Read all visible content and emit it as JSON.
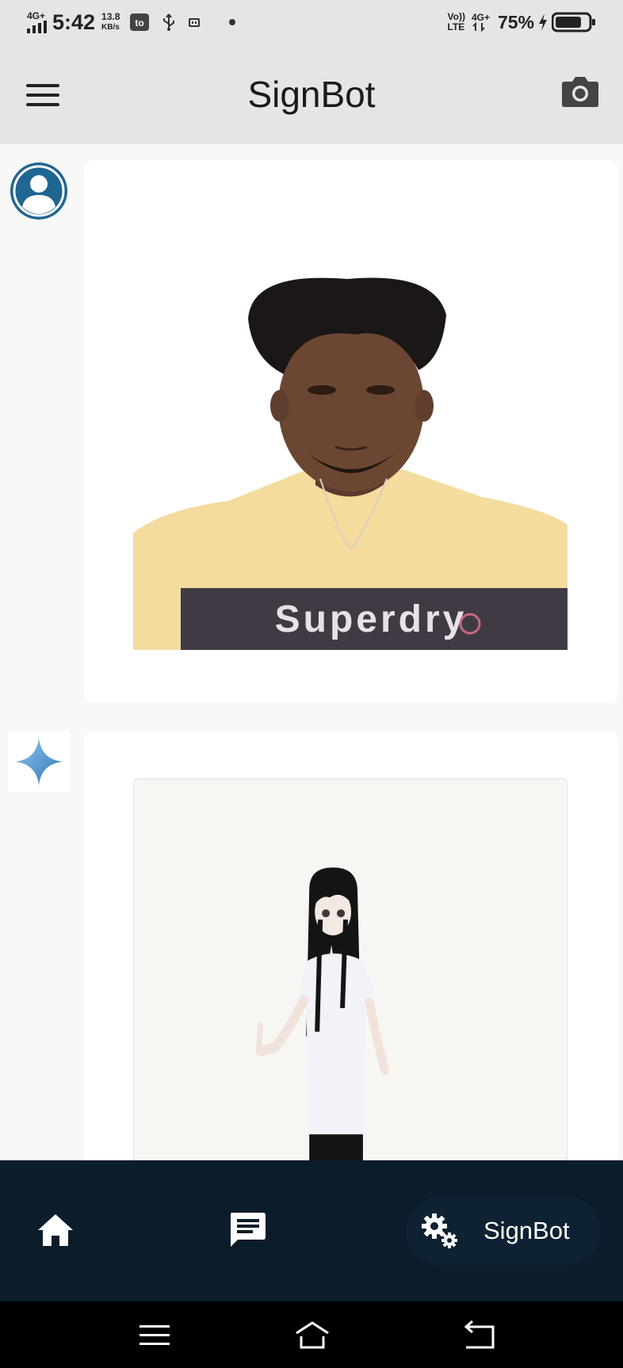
{
  "status_bar": {
    "network_left": "4G+",
    "time": "5:42",
    "speed_value": "13.8",
    "speed_unit": "KB/s",
    "volte_top": "Vo))",
    "volte_bottom": "LTE",
    "network_right": "4G+",
    "battery_percent": "75%"
  },
  "app_bar": {
    "title": "SignBot",
    "menu_icon": "hamburger-menu-icon",
    "camera_icon": "camera-icon"
  },
  "chat": {
    "messages": [
      {
        "sender": "user",
        "avatar_icon": "user-avatar-icon",
        "content": "photo"
      },
      {
        "sender": "bot",
        "avatar_icon": "sparkle-icon",
        "content": "sign-language-avatar-video"
      }
    ]
  },
  "bottom_nav": {
    "home_icon": "home-icon",
    "chat_icon": "chat-icon",
    "signbot_icon": "gears-icon",
    "signbot_label": "SignBot"
  },
  "system_nav": {
    "menu_icon": "recents-icon",
    "home_icon": "system-home-icon",
    "back_icon": "back-icon"
  },
  "colors": {
    "app_bar": "#e5e5e5",
    "bottom_nav": "#0b1c2a",
    "avatar_blue": "#1f6693",
    "sparkle_blue": "#4e94c9"
  }
}
